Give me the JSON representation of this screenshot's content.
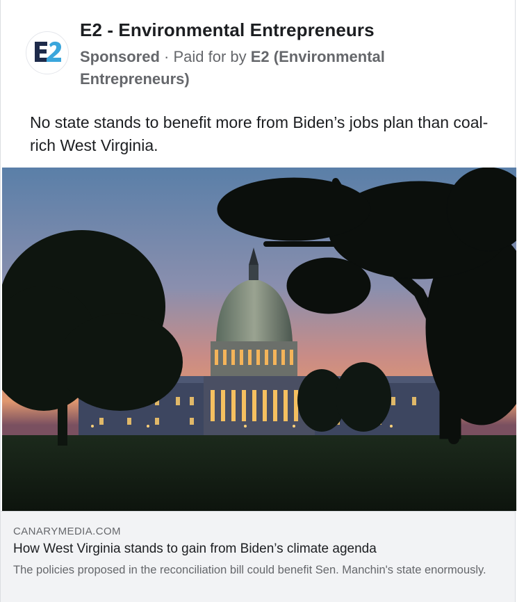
{
  "advertiser": {
    "name": "E2 - Environmental Entrepreneurs",
    "logo_text": "E2",
    "logo_colors": {
      "dark": "#1e2b4a",
      "accent": "#3aa6dc"
    }
  },
  "sponsorship": {
    "label": "Sponsored",
    "separator": " · ",
    "paid_for_prefix": "Paid for by ",
    "payer": "E2 (Environmental Entrepreneurs)"
  },
  "post": {
    "text": "No state stands to benefit more from Biden’s jobs plan than coal-rich West Virginia."
  },
  "image": {
    "subject": "US Capitol building at dusk framed by silhouetted trees"
  },
  "link_preview": {
    "domain": "CANARYMEDIA.COM",
    "title": "How West Virginia stands to gain from Biden’s climate agenda",
    "description": "The policies proposed in the reconciliation bill could benefit Sen. Manchin's state enormously."
  }
}
